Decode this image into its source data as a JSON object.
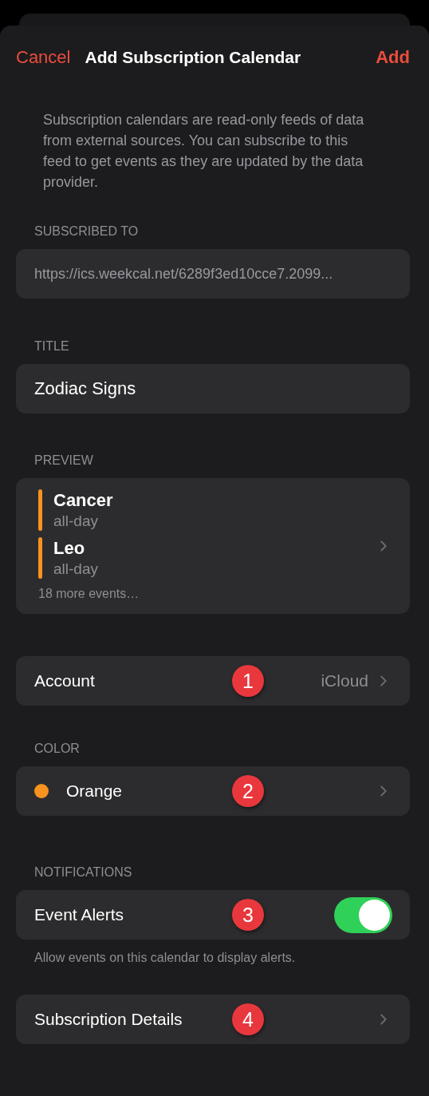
{
  "nav": {
    "cancel": "Cancel",
    "title": "Add Subscription Calendar",
    "add": "Add"
  },
  "description": "Subscription calendars are read-only feeds of data from external sources. You can subscribe to this feed to get events as they are updated by the data provider.",
  "sections": [
    {
      "kind": "url",
      "header": "SUBSCRIBED TO",
      "value": "https://ics.weekcal.net/6289f3ed10cce7.2099..."
    },
    {
      "kind": "text",
      "header": "TITLE",
      "value": "Zodiac Signs"
    },
    {
      "kind": "preview",
      "header": "PREVIEW",
      "events": [
        {
          "name": "Cancer",
          "time": "all-day",
          "color": "#f7931e"
        },
        {
          "name": "Leo",
          "time": "all-day",
          "color": "#f7931e"
        }
      ],
      "more": "18 more events…"
    },
    {
      "kind": "link",
      "label": "Account",
      "value": "iCloud",
      "callout": "1"
    },
    {
      "kind": "color",
      "header": "COLOR",
      "label": "Orange",
      "color": "#f7931e",
      "callout": "2"
    },
    {
      "kind": "toggle",
      "header": "NOTIFICATIONS",
      "label": "Event Alerts",
      "on": true,
      "callout": "3",
      "footer": "Allow events on this calendar to display alerts."
    },
    {
      "kind": "link",
      "label": "Subscription Details",
      "callout": "4"
    }
  ]
}
